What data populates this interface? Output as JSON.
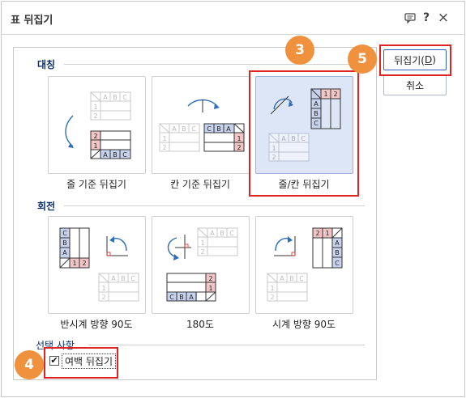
{
  "dialog": {
    "title": "표 뒤집기",
    "title_icons": [
      "chat-icon",
      "help-icon",
      "close-icon"
    ],
    "help_glyph": "?",
    "close_glyph": "×"
  },
  "sections": {
    "symmetry_label": "대칭",
    "rotate_label": "회전",
    "options_label": "선택 사항"
  },
  "symmetry_options": [
    {
      "label": "줄 기준 뒤집기",
      "selected": false
    },
    {
      "label": "칸 기준 뒤집기",
      "selected": false
    },
    {
      "label": "줄/칸 뒤집기",
      "selected": true
    }
  ],
  "rotate_options": [
    {
      "label": "반시계 방향 90도"
    },
    {
      "label": "180도"
    },
    {
      "label": "시계 방향 90도"
    }
  ],
  "options": {
    "flip_margin_label": "여백 뒤집기",
    "flip_margin_checked": true
  },
  "buttons": {
    "ok_label": "뒤집기(D)",
    "ok_prefix": "뒤집기(",
    "ok_mnemonic": "D",
    "ok_suffix": ")",
    "cancel_label": "취소"
  },
  "annotations": {
    "badges": [
      "3",
      "4",
      "5"
    ]
  },
  "table_letters": {
    "a": "A",
    "b": "B",
    "c": "C",
    "one": "1",
    "two": "2"
  },
  "colors": {
    "badge": "#f0913e",
    "highlight_box": "#e02424",
    "selected_card": "#dce6f7",
    "header_blue": "#c7d3ec",
    "header_red": "#f2c6c6",
    "arrow_blue": "#2f6fb5"
  }
}
